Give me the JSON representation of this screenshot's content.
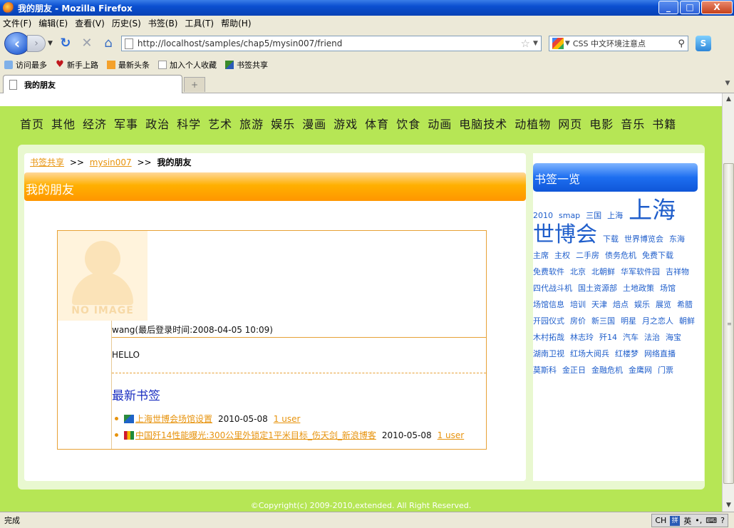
{
  "window": {
    "title": "我的朋友 - Mozilla Firefox"
  },
  "menubar": [
    "文件(F)",
    "编辑(E)",
    "查看(V)",
    "历史(S)",
    "书签(B)",
    "工具(T)",
    "帮助(H)"
  ],
  "navbar": {
    "url": "http://localhost/samples/chap5/mysin007/friend",
    "search": "CSS 中文环境注意点"
  },
  "bookmarks": [
    "访问最多",
    "新手上路",
    "最新头条",
    "加入个人收藏",
    "书签共享"
  ],
  "tab": {
    "label": "我的朋友",
    "newtab": "+"
  },
  "channels": [
    "首页",
    "其他",
    "经济",
    "军事",
    "政治",
    "科学",
    "艺术",
    "旅游",
    "娱乐",
    "漫画",
    "游戏",
    "体育",
    "饮食",
    "动画",
    "电脑技术",
    "动植物",
    "网页",
    "电影",
    "音乐",
    "书籍"
  ],
  "breadcrumb": {
    "root": "书签共享",
    "user": "mysin007",
    "current": "我的朋友",
    "sep": ">>"
  },
  "section": {
    "title": "我的朋友"
  },
  "friend": {
    "avatar_text": "NO IMAGE",
    "login": "wang(最后登录时间:2008-04-05 10:09)",
    "message": "HELLO",
    "latest_title": "最新书签",
    "bookmarks": [
      {
        "title": "上海世博会场馆设置",
        "date": "2010-05-08",
        "users": "1 user"
      },
      {
        "title": "中国歼14性能曝光:300公里外锁定1平米目标_伤天剑_新浪博客",
        "date": "2010-05-08",
        "users": "1 user"
      }
    ]
  },
  "sidebar": {
    "title": "书签一览",
    "tags": [
      {
        "t": "2010",
        "s": 1
      },
      {
        "t": "smap",
        "s": 1
      },
      {
        "t": "三国",
        "s": 1
      },
      {
        "t": "上海",
        "s": 1
      },
      {
        "t": "上海",
        "s": 4
      },
      {
        "t": "世博会",
        "s": 3
      },
      {
        "t": "下载",
        "s": 1
      },
      {
        "t": "世界博览会",
        "s": 1
      },
      {
        "t": "东海",
        "s": 1
      },
      {
        "t": "主席",
        "s": 1
      },
      {
        "t": "主权",
        "s": 1
      },
      {
        "t": "二手房",
        "s": 1
      },
      {
        "t": "债务危机",
        "s": 1
      },
      {
        "t": "免费下载",
        "s": 1
      },
      {
        "t": "免费软件",
        "s": 1
      },
      {
        "t": "北京",
        "s": 1
      },
      {
        "t": "北朝鲜",
        "s": 1
      },
      {
        "t": "华军软件园",
        "s": 1
      },
      {
        "t": "吉祥物",
        "s": 1
      },
      {
        "t": "四代战斗机",
        "s": 1
      },
      {
        "t": "国土资源部",
        "s": 1
      },
      {
        "t": "土地政策",
        "s": 1
      },
      {
        "t": "场馆",
        "s": 1
      },
      {
        "t": "场馆信息",
        "s": 1
      },
      {
        "t": "培训",
        "s": 1
      },
      {
        "t": "天津",
        "s": 1
      },
      {
        "t": "焙点",
        "s": 1
      },
      {
        "t": "娱乐",
        "s": 1
      },
      {
        "t": "展览",
        "s": 1
      },
      {
        "t": "希腊",
        "s": 1
      },
      {
        "t": "开园仪式",
        "s": 1
      },
      {
        "t": "房价",
        "s": 1
      },
      {
        "t": "新三国",
        "s": 1
      },
      {
        "t": "明星",
        "s": 1
      },
      {
        "t": "月之恋人",
        "s": 1
      },
      {
        "t": "朝鲜",
        "s": 1
      },
      {
        "t": "木村拓哉",
        "s": 1
      },
      {
        "t": "林志玲",
        "s": 1
      },
      {
        "t": "歼14",
        "s": 1
      },
      {
        "t": "汽车",
        "s": 1
      },
      {
        "t": "法治",
        "s": 1
      },
      {
        "t": "海宝",
        "s": 1
      },
      {
        "t": "湖南卫视",
        "s": 1
      },
      {
        "t": "红场大阅兵",
        "s": 1
      },
      {
        "t": "红楼梦",
        "s": 1
      },
      {
        "t": "网络直播",
        "s": 1
      },
      {
        "t": "莫斯科",
        "s": 1
      },
      {
        "t": "金正日",
        "s": 1
      },
      {
        "t": "金融危机",
        "s": 1
      },
      {
        "t": "金鹰网",
        "s": 1
      },
      {
        "t": "门票",
        "s": 1
      }
    ]
  },
  "footer": "©Copyright(c) 2009-2010,extended. All Right Reserved.",
  "statusbar": {
    "text": "完成",
    "ime_lang": "CH",
    "ime_mode": "英"
  }
}
